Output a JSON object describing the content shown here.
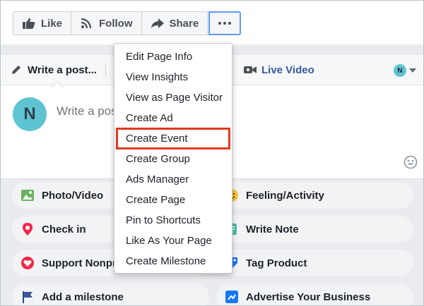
{
  "toolbar": {
    "like_label": "Like",
    "follow_label": "Follow",
    "share_label": "Share",
    "more_icon": "ellipsis-icon"
  },
  "composer": {
    "write_tab": "Write a post...",
    "live_tab": "Live Video",
    "avatar_letter": "N",
    "placeholder": "Write a post..."
  },
  "menu": {
    "items": [
      "Edit Page Info",
      "View Insights",
      "View as Page Visitor",
      "Create Ad",
      "Create Event",
      "Create Group",
      "Ads Manager",
      "Create Page",
      "Pin to Shortcuts",
      "Like As Your Page",
      "Create Milestone"
    ],
    "highlighted": "Create Event",
    "highlight_color": "#e03a1e"
  },
  "actions": [
    {
      "label": "Photo/Video",
      "icon": "photo-icon"
    },
    {
      "label": "Feeling/Activity",
      "icon": "smiley-icon"
    },
    {
      "label": "Check in",
      "icon": "location-pin-icon"
    },
    {
      "label": "Write Note",
      "icon": "note-icon"
    },
    {
      "label": "Support Nonprofit",
      "icon": "heart-icon"
    },
    {
      "label": "Tag Product",
      "icon": "tag-icon"
    },
    {
      "label": "Add a milestone",
      "icon": "flag-icon"
    },
    {
      "label": "Advertise Your Business",
      "icon": "advertise-icon"
    }
  ],
  "colors": {
    "accent": "#365899",
    "focus_border": "#5b9cf2",
    "avatar": "#5fc4d2"
  }
}
